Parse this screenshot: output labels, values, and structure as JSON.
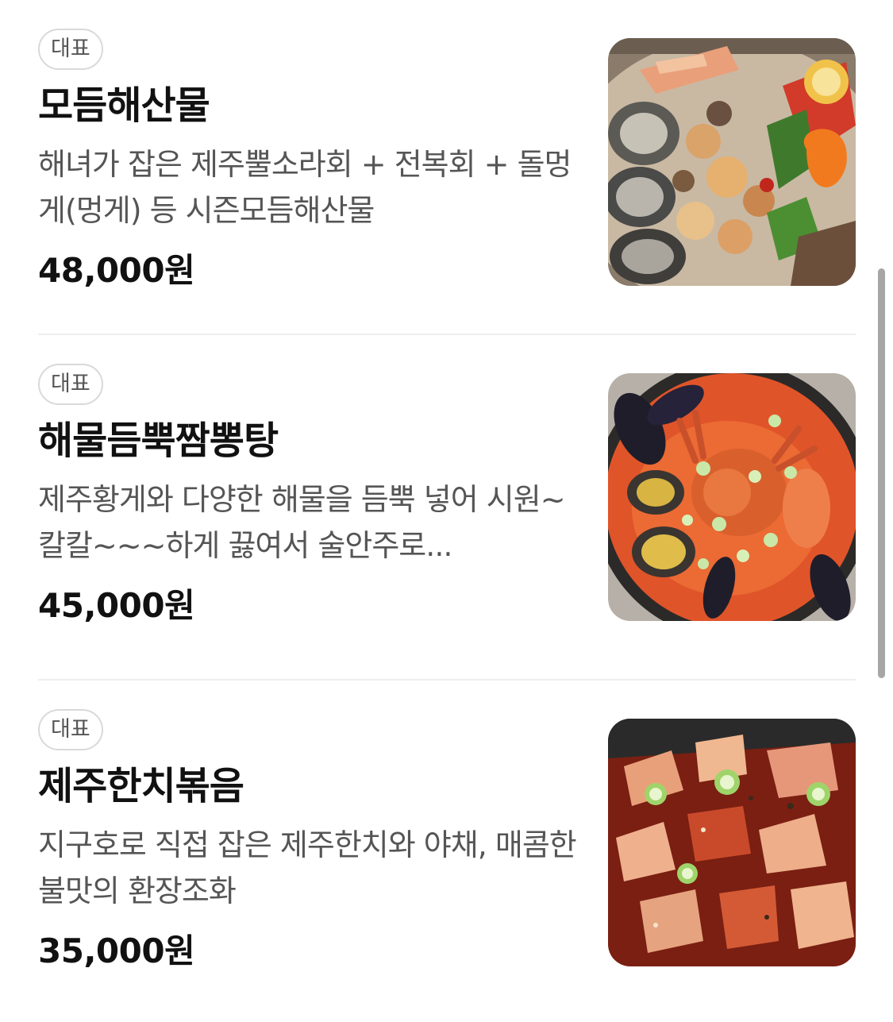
{
  "menu": {
    "items": [
      {
        "badge": "대표",
        "name": "모듬해산물",
        "description": "해녀가 잡은 제주뿔소라회 + 전복회 + 돌멍게(멍게) 등 시즌모듬해산물",
        "price": "48,000원",
        "image": "seafood-platter-photo"
      },
      {
        "badge": "대표",
        "name": "해물듬뿍짬뽕탕",
        "description": "제주황게와 다양한 해물을 듬뿍 넣어 시원~ 칼칼~~~하게 끓여서 술안주로...",
        "price": "45,000원",
        "image": "jjamppong-stew-photo"
      },
      {
        "badge": "대표",
        "name": "제주한치볶음",
        "description": "지구호로 직접 잡은 제주한치와 야채, 매콤한 불맛의 환장조화",
        "price": "35,000원",
        "image": "stir-fried-squid-photo"
      }
    ]
  }
}
